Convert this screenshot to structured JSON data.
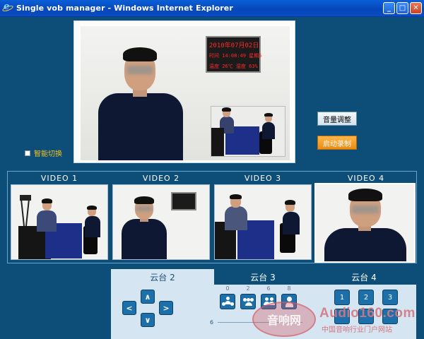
{
  "window": {
    "title": "Single vob manager - Windows Internet Explorer",
    "buttons": [
      "_",
      "□",
      "✕"
    ]
  },
  "main_view": {
    "clock_line1": "2010年07月02日",
    "clock_line2": "时间 14:08:49 星期5",
    "clock_line3": "温度 26℃ 湿度 63%"
  },
  "controls": {
    "volume_button": "音量调整",
    "record_button": "启动录制",
    "smart_switch_label": "智能切换",
    "smart_switch_checked": false
  },
  "videos": [
    {
      "label": "VIDEO 1",
      "selected": false
    },
    {
      "label": "VIDEO 2",
      "selected": false
    },
    {
      "label": "VIDEO 3",
      "selected": false
    },
    {
      "label": "VIDEO 4",
      "selected": true
    }
  ],
  "ptz": {
    "tabs": [
      "云台 2",
      "云台 3",
      "云台 4"
    ],
    "active_tab": "云台 2",
    "arrows": {
      "up": "∧",
      "down": "∨",
      "left": "<",
      "right": ">"
    },
    "preset_labels": [
      "0",
      "2",
      "6",
      "8"
    ],
    "number_buttons": [
      "1",
      "2",
      "3"
    ],
    "slider_value": "6"
  },
  "watermark": {
    "logo": "音响网",
    "text": "Audio160.com",
    "subtext": "中国音响行业门户网站"
  }
}
